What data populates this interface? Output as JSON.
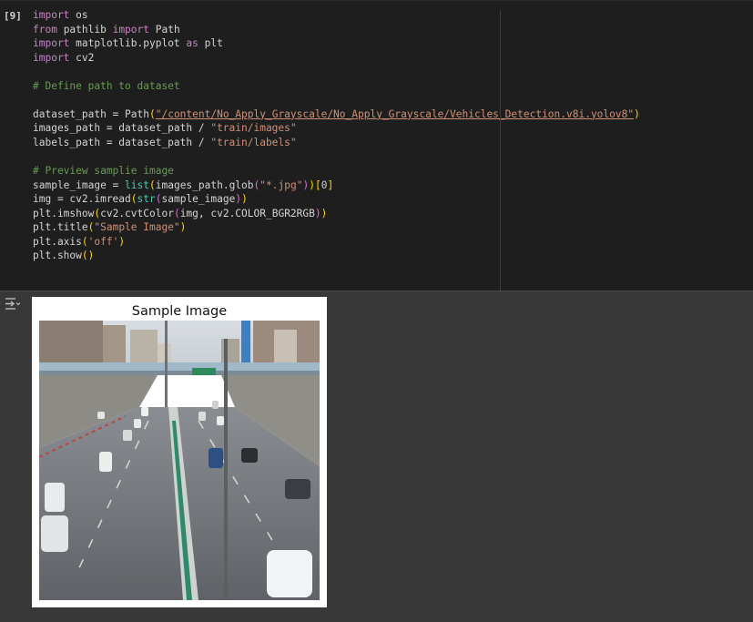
{
  "cell": {
    "execution_count": "[9]",
    "code_lines": [
      [
        {
          "t": "import",
          "c": "kw"
        },
        {
          "t": " os"
        }
      ],
      [
        {
          "t": "from",
          "c": "kw"
        },
        {
          "t": " pathlib "
        },
        {
          "t": "import",
          "c": "kw"
        },
        {
          "t": " Path"
        }
      ],
      [
        {
          "t": "import",
          "c": "kw"
        },
        {
          "t": " matplotlib.pyplot "
        },
        {
          "t": "as",
          "c": "kw"
        },
        {
          "t": " plt"
        }
      ],
      [
        {
          "t": "import",
          "c": "kw"
        },
        {
          "t": " cv2"
        }
      ],
      [],
      [
        {
          "t": "# Define path to dataset",
          "c": "cm"
        }
      ],
      [],
      [
        {
          "t": "dataset_path = Path"
        },
        {
          "t": "(",
          "c": "br1"
        },
        {
          "t": "\"/content/No_Apply_Grayscale/No_Apply_Grayscale/Vehicles_Detection.v8i.yolov8\"",
          "c": "str link"
        },
        {
          "t": ")",
          "c": "br1"
        }
      ],
      [
        {
          "t": "images_path = dataset_path / "
        },
        {
          "t": "\"train/images\"",
          "c": "str"
        }
      ],
      [
        {
          "t": "labels_path = dataset_path / "
        },
        {
          "t": "\"train/labels\"",
          "c": "str"
        }
      ],
      [],
      [
        {
          "t": "# Preview samplie image",
          "c": "cm"
        }
      ],
      [
        {
          "t": "sample_image = "
        },
        {
          "t": "list",
          "c": "fn"
        },
        {
          "t": "(",
          "c": "br1"
        },
        {
          "t": "images_path.glob"
        },
        {
          "t": "(",
          "c": "br2"
        },
        {
          "t": "\"*.jpg\"",
          "c": "str"
        },
        {
          "t": ")",
          "c": "br2"
        },
        {
          "t": ")",
          "c": "br1"
        },
        {
          "t": "[",
          "c": "br1"
        },
        {
          "t": "0"
        },
        {
          "t": "]",
          "c": "br1"
        }
      ],
      [
        {
          "t": "img = cv2.imread"
        },
        {
          "t": "(",
          "c": "br1"
        },
        {
          "t": "str",
          "c": "fn"
        },
        {
          "t": "(",
          "c": "br2"
        },
        {
          "t": "sample_image"
        },
        {
          "t": ")",
          "c": "br2"
        },
        {
          "t": ")",
          "c": "br1"
        }
      ],
      [
        {
          "t": "plt.imshow"
        },
        {
          "t": "(",
          "c": "br1"
        },
        {
          "t": "cv2.cvtColor"
        },
        {
          "t": "(",
          "c": "br2"
        },
        {
          "t": "img, cv2.COLOR_BGR2RGB"
        },
        {
          "t": ")",
          "c": "br2"
        },
        {
          "t": ")",
          "c": "br1"
        }
      ],
      [
        {
          "t": "plt.title"
        },
        {
          "t": "(",
          "c": "br1"
        },
        {
          "t": "\"Sample Image\"",
          "c": "str"
        },
        {
          "t": ")",
          "c": "br1"
        }
      ],
      [
        {
          "t": "plt.axis"
        },
        {
          "t": "(",
          "c": "br1"
        },
        {
          "t": "'off'",
          "c": "str"
        },
        {
          "t": ")",
          "c": "br1"
        }
      ],
      [
        {
          "t": "plt.show"
        },
        {
          "t": "()",
          "c": "br1"
        }
      ]
    ]
  },
  "output": {
    "icon": "output-toggle-icon",
    "figure_title": "Sample Image"
  },
  "colors": {
    "cell_bg": "#1e1e1e",
    "output_bg": "#383838",
    "keyword": "#c586c0",
    "comment": "#6a9955",
    "string": "#ce9178",
    "builtin": "#4ec9b0"
  }
}
